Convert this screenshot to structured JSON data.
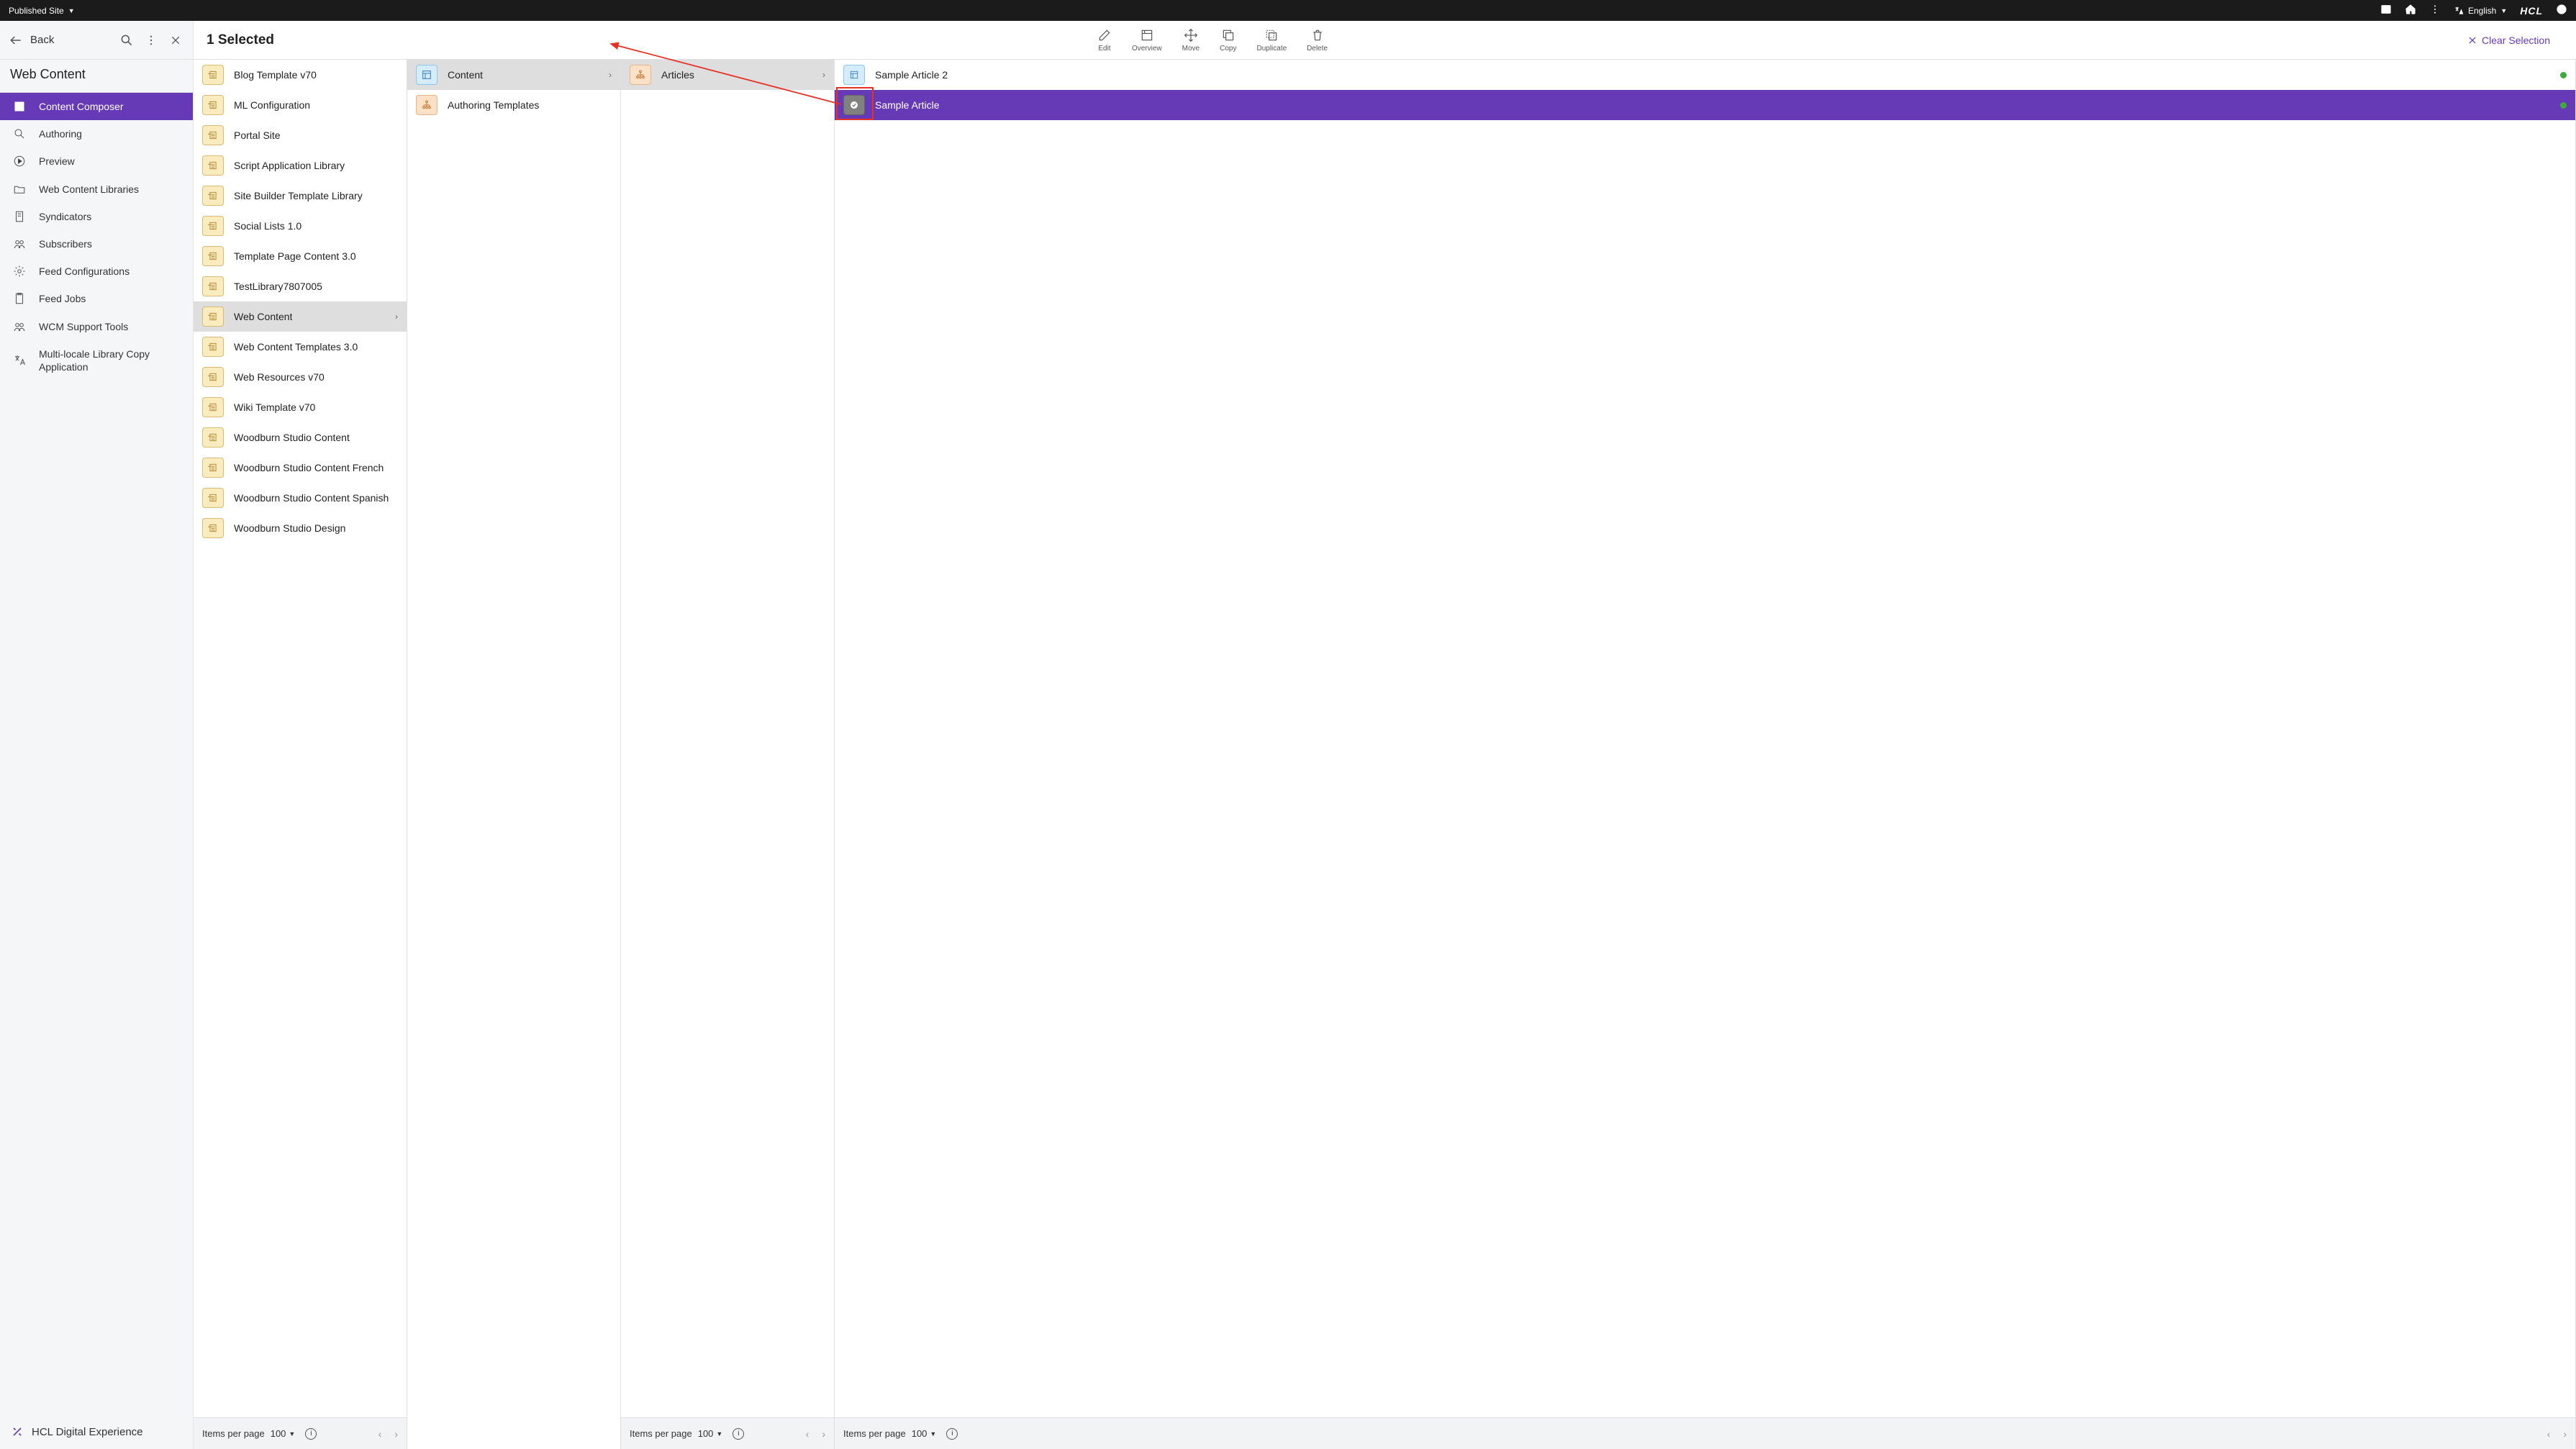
{
  "topbar": {
    "siteMode": "Published Site",
    "language": "English",
    "brand": "HCL"
  },
  "header": {
    "back": "Back",
    "selectedCount": "1 Selected",
    "toolbar": [
      {
        "id": "edit",
        "label": "Edit"
      },
      {
        "id": "overview",
        "label": "Overview"
      },
      {
        "id": "move",
        "label": "Move"
      },
      {
        "id": "copy",
        "label": "Copy"
      },
      {
        "id": "duplicate",
        "label": "Duplicate"
      },
      {
        "id": "delete",
        "label": "Delete"
      }
    ],
    "clearSelection": "Clear Selection"
  },
  "sidebar": {
    "title": "Web Content",
    "items": [
      {
        "id": "content-composer",
        "label": "Content Composer",
        "active": true
      },
      {
        "id": "authoring",
        "label": "Authoring"
      },
      {
        "id": "preview",
        "label": "Preview"
      },
      {
        "id": "libraries",
        "label": "Web Content Libraries"
      },
      {
        "id": "syndicators",
        "label": "Syndicators"
      },
      {
        "id": "subscribers",
        "label": "Subscribers"
      },
      {
        "id": "feed-config",
        "label": "Feed Configurations"
      },
      {
        "id": "feed-jobs",
        "label": "Feed Jobs"
      },
      {
        "id": "wcm-support",
        "label": "WCM Support Tools"
      },
      {
        "id": "mllc",
        "label": "Multi-locale Library Copy Application"
      }
    ],
    "footer": "HCL Digital Experience"
  },
  "libraries": [
    {
      "label": "Blog Template v70"
    },
    {
      "label": "ML Configuration"
    },
    {
      "label": "Portal Site"
    },
    {
      "label": "Script Application Library"
    },
    {
      "label": "Site Builder Template Library"
    },
    {
      "label": "Social Lists 1.0"
    },
    {
      "label": "Template Page Content 3.0"
    },
    {
      "label": "TestLibrary7807005"
    },
    {
      "label": "Web Content",
      "highlight": true,
      "chevron": true
    },
    {
      "label": "Web Content Templates 3.0"
    },
    {
      "label": "Web Resources v70"
    },
    {
      "label": "Wiki Template v70"
    },
    {
      "label": "Woodburn Studio Content"
    },
    {
      "label": "Woodburn Studio Content French"
    },
    {
      "label": "Woodburn Studio Content Spanish"
    },
    {
      "label": "Woodburn Studio Design"
    }
  ],
  "col2": [
    {
      "label": "Content",
      "type": "site",
      "highlight": true,
      "chevron": true
    },
    {
      "label": "Authoring Templates",
      "type": "sitearea"
    }
  ],
  "col3": [
    {
      "label": "Articles",
      "type": "sitearea",
      "highlight": true,
      "chevron": true
    }
  ],
  "col4": [
    {
      "label": "Sample Article 2",
      "type": "content",
      "status": "green"
    },
    {
      "label": "Sample Article",
      "type": "content-sel",
      "selected": true,
      "status": "green"
    }
  ],
  "pagination": {
    "itemsPerPageLabel": "Items per page",
    "perPage": "100"
  }
}
